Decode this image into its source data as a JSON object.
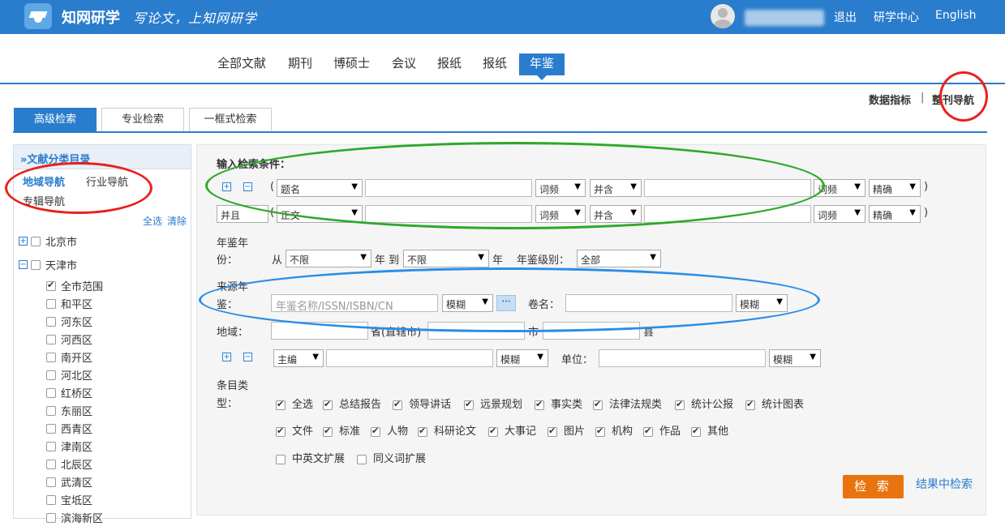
{
  "header": {
    "logo_text": "知网研学",
    "slogan": "写论文，上知网研学",
    "links": [
      "退出",
      "研学中心",
      "English"
    ]
  },
  "nav": {
    "tabs": [
      "全部文献",
      "期刊",
      "博硕士",
      "会议",
      "报纸",
      "报纸",
      "年鉴"
    ],
    "active": "年鉴"
  },
  "right_links": {
    "data_index": "数据指标",
    "separator": "|",
    "full_nav": "整刊导航"
  },
  "search_tabs": [
    "高级检索",
    "专业检索",
    "一框式检索"
  ],
  "sidebar": {
    "title": "»文献分类目录",
    "nav": [
      "地域导航",
      "行业导航",
      "专辑导航"
    ],
    "select_all": "全选",
    "clear": "清除",
    "tree": [
      {
        "label": "北京市",
        "expander": "+",
        "checked": false
      },
      {
        "label": "天津市",
        "expander": "−",
        "checked": false
      },
      {
        "label": "全市范围",
        "checked": true
      },
      {
        "label": "和平区",
        "checked": false
      },
      {
        "label": "河东区",
        "checked": false
      },
      {
        "label": "河西区",
        "checked": false
      },
      {
        "label": "南开区",
        "checked": false
      },
      {
        "label": "河北区",
        "checked": false
      },
      {
        "label": "红桥区",
        "checked": false
      },
      {
        "label": "东丽区",
        "checked": false
      },
      {
        "label": "西青区",
        "checked": false
      },
      {
        "label": "津南区",
        "checked": false
      },
      {
        "label": "北辰区",
        "checked": false
      },
      {
        "label": "武清区",
        "checked": false
      },
      {
        "label": "宝坻区",
        "checked": false
      },
      {
        "label": "滨海新区",
        "checked": false
      }
    ]
  },
  "form": {
    "section_title": "输入检索条件：",
    "row1": {
      "open_paren": "(",
      "field": "题名",
      "freq": "词频",
      "logic": "并含",
      "freq2": "词频",
      "match": "精确",
      "close_paren": ")"
    },
    "row2": {
      "bool": "并且",
      "open_paren": "(",
      "field": "正文",
      "freq": "词频",
      "logic": "并含",
      "freq2": "词频",
      "match": "精确",
      "close_paren": ")"
    },
    "year": {
      "label1": "年鉴年",
      "label2": "份：",
      "from": "从",
      "from_value": "不限",
      "year_to": "年 到",
      "to_value": "不限",
      "year": "年",
      "level_label": "年鉴级别：",
      "level_value": "全部"
    },
    "source": {
      "label1": "来源年",
      "label2": "鉴：",
      "placeholder": "年鉴名称/ISSN/ISBN/CN",
      "match": "模糊",
      "dots": "···",
      "volume_label": "卷名：",
      "volume_match": "模糊"
    },
    "region": {
      "label": "地域：",
      "province": "省(直辖市)",
      "city": "市",
      "county": "县"
    },
    "editor": {
      "field": "主编",
      "match": "模糊",
      "unit_label": "单位：",
      "unit_match": "模糊"
    },
    "entry_type": {
      "label1": "条目类",
      "label2": "型：",
      "row1": [
        "全选",
        "总结报告",
        "领导讲话",
        "远景规划",
        "事实类",
        "法律法规类",
        "统计公报",
        "统计图表"
      ],
      "row2": [
        "文件",
        "标准",
        "人物",
        "科研论文",
        "大事记",
        "图片",
        "机构",
        "作品",
        "其他"
      ],
      "row3": [
        "中英文扩展",
        "同义词扩展"
      ]
    },
    "search_button": "检 索",
    "search_in_results": "结果中检索"
  },
  "colors": {
    "brand": "#2a7ccd",
    "search_button": "#e8740f",
    "annotation_red": "#e8211c",
    "annotation_green": "#2ea82a",
    "annotation_blue": "#2a8de8"
  }
}
